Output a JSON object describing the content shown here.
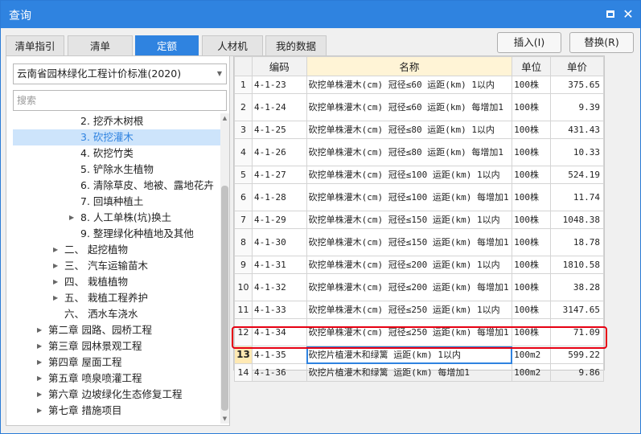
{
  "window": {
    "title": "查询",
    "max_icon": "maximize-icon",
    "close_icon": "close-icon"
  },
  "tabs": [
    {
      "label": "清单指引",
      "active": false
    },
    {
      "label": "清单",
      "active": false
    },
    {
      "label": "定额",
      "active": true
    },
    {
      "label": "人材机",
      "active": false
    },
    {
      "label": "我的数据",
      "active": false
    }
  ],
  "buttons": {
    "insert": "插入(I)",
    "replace": "替换(R)"
  },
  "left": {
    "standard": "云南省园林绿化工程计价标准(2020)",
    "search_placeholder": "搜索",
    "tree": [
      {
        "label": "2. 挖乔木树根",
        "toggle": ""
      },
      {
        "label": "3. 砍挖灌木",
        "toggle": "",
        "selected": true
      },
      {
        "label": "4. 砍挖竹类",
        "toggle": ""
      },
      {
        "label": "5. 铲除水生植物",
        "toggle": ""
      },
      {
        "label": "6. 清除草皮、地被、露地花卉",
        "toggle": ""
      },
      {
        "label": "7. 回填种植土",
        "toggle": ""
      },
      {
        "label": "8. 人工单株(坑)换土",
        "toggle": "▶"
      },
      {
        "label": "9. 整理绿化种植地及其他",
        "toggle": ""
      },
      {
        "label": "二、  起挖植物",
        "toggle": "▶"
      },
      {
        "label": "三、  汽车运输苗木",
        "toggle": "▶"
      },
      {
        "label": "四、  栽植植物",
        "toggle": "▶"
      },
      {
        "label": "五、  栽植工程养护",
        "toggle": "▶"
      },
      {
        "label": "六、  洒水车浇水",
        "toggle": ""
      },
      {
        "label": "第二章 园路、园桥工程",
        "toggle": "▶"
      },
      {
        "label": "第三章 园林景观工程",
        "toggle": "▶"
      },
      {
        "label": "第四章 屋面工程",
        "toggle": "▶"
      },
      {
        "label": "第五章 喷泉喷灌工程",
        "toggle": "▶"
      },
      {
        "label": "第六章 边坡绿化生态修复工程",
        "toggle": "▶"
      },
      {
        "label": "第七章 措施项目",
        "toggle": "▶"
      }
    ]
  },
  "grid": {
    "columns": {
      "code": "编码",
      "name": "名称",
      "unit": "单位",
      "price": "单价"
    },
    "rows": [
      {
        "n": "1",
        "code": "4-1-23",
        "name": "砍挖单株灌木(cm) 冠径≤60 运距(km) 1以内",
        "unit": "100株",
        "price": "375.65"
      },
      {
        "n": "2",
        "code": "4-1-24",
        "name": "砍挖单株灌木(cm) 冠径≤60 运距(km) 每增加1",
        "unit": "100株",
        "price": "9.39"
      },
      {
        "n": "3",
        "code": "4-1-25",
        "name": "砍挖单株灌木(cm) 冠径≤80 运距(km) 1以内",
        "unit": "100株",
        "price": "431.43"
      },
      {
        "n": "4",
        "code": "4-1-26",
        "name": "砍挖单株灌木(cm) 冠径≤80 运距(km) 每增加1",
        "unit": "100株",
        "price": "10.33"
      },
      {
        "n": "5",
        "code": "4-1-27",
        "name": "砍挖单株灌木(cm) 冠径≤100 运距(km) 1以内",
        "unit": "100株",
        "price": "524.19"
      },
      {
        "n": "6",
        "code": "4-1-28",
        "name": "砍挖单株灌木(cm) 冠径≤100 运距(km) 每增加1",
        "unit": "100株",
        "price": "11.74"
      },
      {
        "n": "7",
        "code": "4-1-29",
        "name": "砍挖单株灌木(cm) 冠径≤150 运距(km) 1以内",
        "unit": "100株",
        "price": "1048.38"
      },
      {
        "n": "8",
        "code": "4-1-30",
        "name": "砍挖单株灌木(cm) 冠径≤150 运距(km) 每增加1",
        "unit": "100株",
        "price": "18.78"
      },
      {
        "n": "9",
        "code": "4-1-31",
        "name": "砍挖单株灌木(cm) 冠径≤200 运距(km) 1以内",
        "unit": "100株",
        "price": "1810.58"
      },
      {
        "n": "10",
        "code": "4-1-32",
        "name": "砍挖单株灌木(cm) 冠径≤200 运距(km) 每增加1",
        "unit": "100株",
        "price": "38.28"
      },
      {
        "n": "11",
        "code": "4-1-33",
        "name": "砍挖单株灌木(cm) 冠径≤250 运距(km) 1以内",
        "unit": "100株",
        "price": "3147.65"
      },
      {
        "n": "12",
        "code": "4-1-34",
        "name": "砍挖单株灌木(cm) 冠径≤250 运距(km) 每增加1",
        "unit": "100株",
        "price": "71.09"
      },
      {
        "n": "13",
        "code": "4-1-35",
        "name": "砍挖片植灌木和绿篱 运距(km) 1以内",
        "unit": "100m2",
        "price": "599.22",
        "highlight": true
      },
      {
        "n": "14",
        "code": "4-1-36",
        "name": "砍挖片植灌木和绿篱 运距(km) 每增加1",
        "unit": "100m2",
        "price": "9.86"
      }
    ]
  }
}
